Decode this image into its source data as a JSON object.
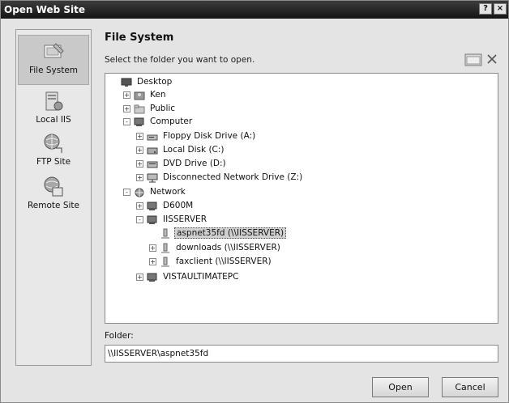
{
  "window": {
    "title": "Open Web Site",
    "help_glyph": "?",
    "close_glyph": "×"
  },
  "places": [
    {
      "label": "File System",
      "icon": "file-system-icon",
      "selected": true
    },
    {
      "label": "Local IIS",
      "icon": "local-iis-icon",
      "selected": false
    },
    {
      "label": "FTP Site",
      "icon": "ftp-site-icon",
      "selected": false
    },
    {
      "label": "Remote Site",
      "icon": "remote-site-icon",
      "selected": false
    }
  ],
  "header": {
    "title": "File System",
    "subtitle": "Select the folder you want to open."
  },
  "tree": [
    {
      "label": "Desktop",
      "icon": "desktop-icon",
      "expander": "none"
    },
    {
      "label": "Ken",
      "icon": "user-folder-icon",
      "expander": "+"
    },
    {
      "label": "Public",
      "icon": "folder-icon",
      "expander": "+"
    },
    {
      "label": "Computer",
      "icon": "computer-icon",
      "expander": "-"
    },
    {
      "label": "Floppy Disk Drive (A:)",
      "icon": "floppy-drive-icon",
      "expander": "+"
    },
    {
      "label": "Local Disk (C:)",
      "icon": "hard-drive-icon",
      "expander": "+"
    },
    {
      "label": "DVD Drive (D:)",
      "icon": "dvd-drive-icon",
      "expander": "+"
    },
    {
      "label": "Disconnected Network Drive (Z:)",
      "icon": "network-drive-icon",
      "expander": "+"
    },
    {
      "label": "Network",
      "icon": "network-icon",
      "expander": "-"
    },
    {
      "label": "D600M",
      "icon": "computer-icon",
      "expander": "+"
    },
    {
      "label": "IISSERVER",
      "icon": "computer-icon",
      "expander": "-"
    },
    {
      "label": "aspnet35fd (\\\\IISSERVER)",
      "icon": "share-icon",
      "expander": "none",
      "selected": true
    },
    {
      "label": "downloads (\\\\IISSERVER)",
      "icon": "share-icon",
      "expander": "+"
    },
    {
      "label": "faxclient (\\\\IISSERVER)",
      "icon": "share-icon",
      "expander": "+"
    },
    {
      "label": "VISTAULTIMATEPC",
      "icon": "computer-icon",
      "expander": "+"
    }
  ],
  "folder": {
    "label": "Folder:",
    "value": "\\\\IISSERVER\\aspnet35fd"
  },
  "buttons": {
    "open": "Open",
    "cancel": "Cancel"
  }
}
